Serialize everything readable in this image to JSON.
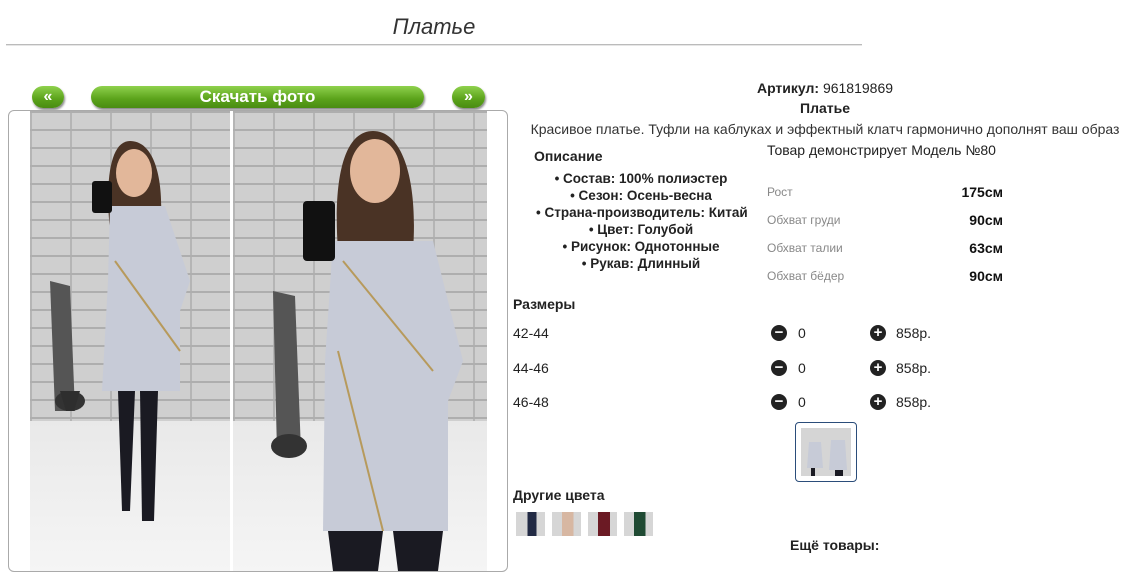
{
  "page": {
    "title": "Платье"
  },
  "nav": {
    "prev": "«",
    "download": "Скачать фото",
    "next": "»"
  },
  "product": {
    "sku_label": "Артикул:",
    "sku_value": "961819869",
    "name": "Платье",
    "description": "Красивое платье. Туфли на каблуках и эффектный клатч гармонично дополнят ваш образ"
  },
  "specs": {
    "heading": "Описание",
    "items": [
      "• Состав: 100% полиэстер",
      "• Сезон: Осень-весна",
      "• Страна-производитель: Китай",
      "• Цвет: Голубой",
      "• Рисунок: Однотонные",
      "• Рукав: Длинный"
    ]
  },
  "model": {
    "heading": "Товар демонстрирует Модель №80",
    "measurements": [
      {
        "label": "Рост",
        "value": "175см"
      },
      {
        "label": "Обхват груди",
        "value": "90см"
      },
      {
        "label": "Обхват талии",
        "value": "63см"
      },
      {
        "label": "Обхват бёдер",
        "value": "90см"
      }
    ]
  },
  "sizes": {
    "heading": "Размеры",
    "rows": [
      {
        "size": "42-44",
        "qty": "0",
        "price": "858р."
      },
      {
        "size": "44-46",
        "qty": "0",
        "price": "858р."
      },
      {
        "size": "46-48",
        "qty": "0",
        "price": "858р."
      }
    ],
    "minus_symbol": "−",
    "plus_symbol": "+"
  },
  "other_colors": {
    "heading": "Другие цвета"
  },
  "more": {
    "heading": "Ещё товары:"
  },
  "colors": {
    "accent": "#5aa21a",
    "dress": "#c7cbd7",
    "boots": "#1a1a22"
  }
}
